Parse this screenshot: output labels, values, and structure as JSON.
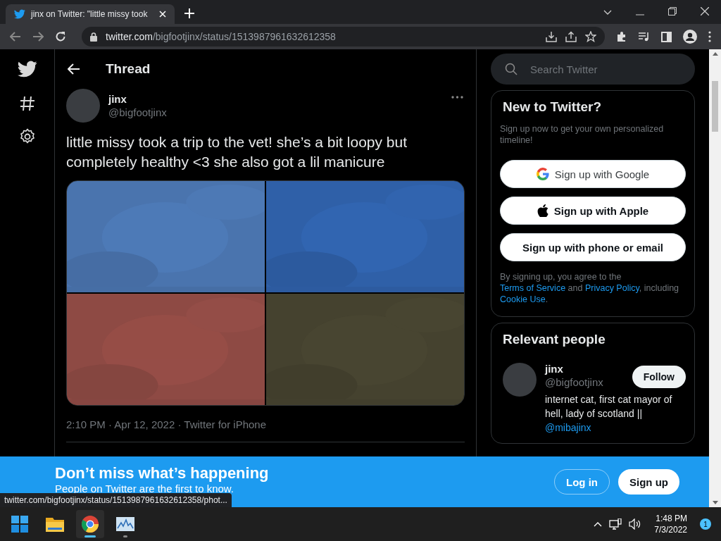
{
  "browser": {
    "tab": {
      "title": "jinx on Twitter: \"little missy took",
      "selected": true
    },
    "url_host": "twitter.com",
    "url_path": "/bigfootjinx/status/1513987961632612358"
  },
  "thread": {
    "title": "Thread",
    "author": {
      "name": "jinx",
      "handle": "@bigfootjinx"
    },
    "text": "little missy took a trip to the vet! she’s a bit loopy but completely healthy <3 she also got a lil manicure",
    "photos": [
      {
        "color": "#4a74ae"
      },
      {
        "color": "#2f60a8"
      },
      {
        "color": "#8e4a44"
      },
      {
        "color": "#45422f"
      }
    ],
    "meta": "2:10 PM · Apr 12, 2022 · Twitter for iPhone"
  },
  "search": {
    "placeholder": "Search Twitter"
  },
  "signup": {
    "title": "New to Twitter?",
    "subtitle": "Sign up now to get your own personalized timeline!",
    "buttons": [
      {
        "kind": "google",
        "label": "Sign up with Google"
      },
      {
        "kind": "apple",
        "label": "Sign up with Apple"
      },
      {
        "kind": "plain",
        "label": "Sign up with phone or email"
      }
    ],
    "legal": [
      "By signing up, you agree to the ",
      "Terms of Service",
      " and ",
      "Privacy Policy",
      ", including ",
      "Cookie Use",
      "."
    ]
  },
  "relevant": {
    "title": "Relevant people",
    "person": {
      "name": "jinx",
      "handle": "@bigfootjinx",
      "bio": "internet cat, first cat mayor of hell, lady of scotland || ",
      "bio_link": "@mibajinx",
      "button": "Follow"
    }
  },
  "banner": {
    "title": "Don’t miss what’s happening",
    "subtitle": "People on Twitter are the first to know.",
    "login": "Log in",
    "signup": "Sign up"
  },
  "status_url": "twitter.com/bigfootjinx/status/1513987961632612358/phot...",
  "taskbar": {
    "apps": [
      {
        "kind": "start",
        "selected": false
      },
      {
        "kind": "explorer",
        "selected": false
      },
      {
        "kind": "chrome",
        "selected": true
      },
      {
        "kind": "monitor",
        "selected": false
      }
    ],
    "time": "1:48 PM",
    "date": "7/3/2022",
    "notifications": "1"
  }
}
